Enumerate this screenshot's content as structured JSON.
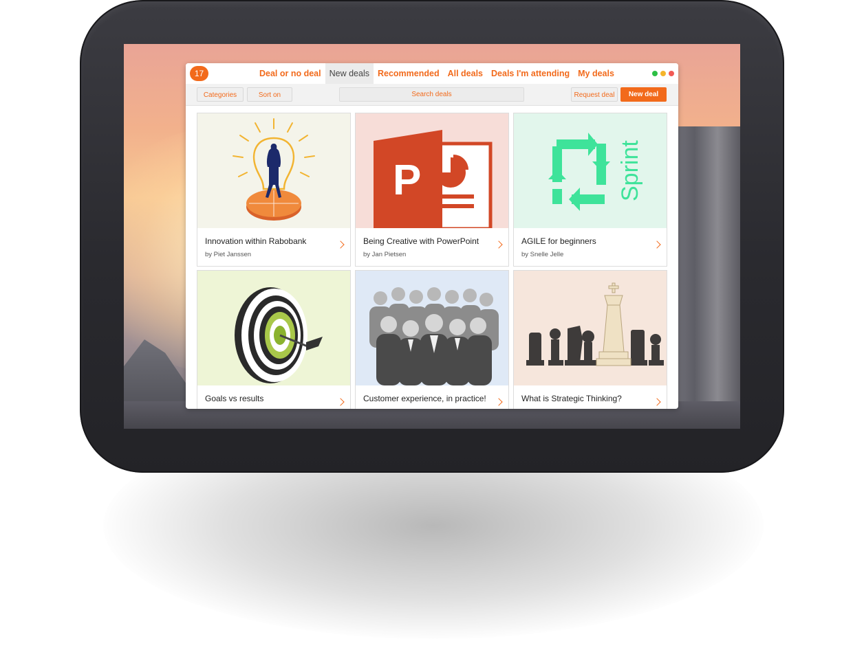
{
  "app": {
    "notification_count": "17",
    "tabs": [
      {
        "label": "Deal or no deal",
        "active": false
      },
      {
        "label": "New deals",
        "active": true
      },
      {
        "label": "Recommended",
        "active": false
      },
      {
        "label": "All deals",
        "active": false
      },
      {
        "label": "Deals I'm attending",
        "active": false
      },
      {
        "label": "My deals",
        "active": false
      }
    ],
    "window_controls": [
      {
        "name": "maximize",
        "color": "#2dbf45"
      },
      {
        "name": "minimize",
        "color": "#f5b52b"
      },
      {
        "name": "close",
        "color": "#f25a55"
      }
    ]
  },
  "toolbar": {
    "categories_label": "Categories",
    "sort_label": "Sort on",
    "search_placeholder": "Search deals",
    "request_label": "Request deal",
    "new_deal_label": "New deal"
  },
  "deals": [
    {
      "title": "Innovation within Rabobank",
      "author": "by Piet Janssen",
      "image": "lightbulb-compass",
      "bg": "#f4f4ea"
    },
    {
      "title": "Being Creative with PowerPoint",
      "author": "by Jan Pietsen",
      "image": "powerpoint-logo",
      "bg": "#f7ddd8"
    },
    {
      "title": "AGILE for beginners",
      "author": "by Snelle Jelle",
      "image": "sprint-cycle",
      "bg": "#e2f6ec",
      "image_text": "Sprint"
    },
    {
      "title": "Goals vs results",
      "author": "",
      "image": "dartboard-target",
      "bg": "#eef5d6"
    },
    {
      "title": "Customer experience, in practice!",
      "author": "",
      "image": "business-team",
      "bg": "#dfe9f6"
    },
    {
      "title": "What is Strategic Thinking?",
      "author": "",
      "image": "chess-pieces",
      "bg": "#f6e6dc"
    }
  ],
  "colors": {
    "accent": "#f26a1b"
  }
}
